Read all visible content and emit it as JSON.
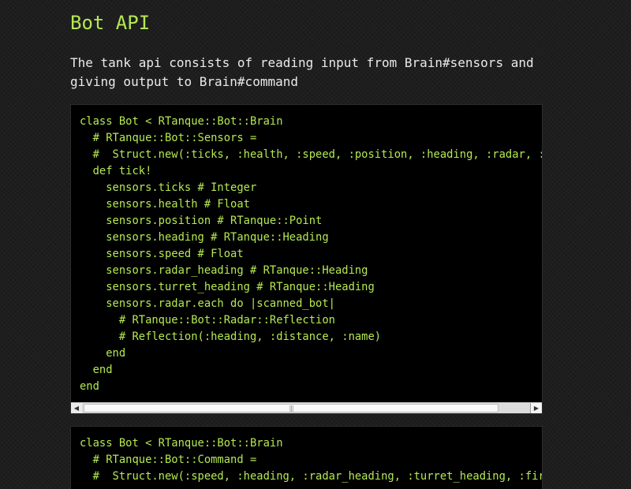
{
  "heading": "Bot API",
  "intro": "The tank api consists of reading input from Brain#sensors and giving output to Brain#command",
  "code_blocks": [
    {
      "lines": [
        "class Bot < RTanque::Bot::Brain",
        "  # RTanque::Bot::Sensors =",
        "  #  Struct.new(:ticks, :health, :speed, :position, :heading, :radar, :turret_heading)",
        "  def tick!",
        "    sensors.ticks # Integer",
        "    sensors.health # Float",
        "    sensors.position # RTanque::Point",
        "    sensors.heading # RTanque::Heading",
        "    sensors.speed # Float",
        "    sensors.radar_heading # RTanque::Heading",
        "    sensors.turret_heading # RTanque::Heading",
        "    sensors.radar.each do |scanned_bot|",
        "      # RTanque::Bot::Radar::Reflection",
        "      # Reflection(:heading, :distance, :name)",
        "    end",
        "  end",
        "end"
      ]
    },
    {
      "lines": [
        "class Bot < RTanque::Bot::Brain",
        "  # RTanque::Bot::Command =",
        "  #  Struct.new(:speed, :heading, :radar_heading, :turret_heading, :fire_power)"
      ]
    }
  ],
  "scrollbar": {
    "left_arrow": "◀",
    "right_arrow": "▶",
    "grip": "|||"
  }
}
